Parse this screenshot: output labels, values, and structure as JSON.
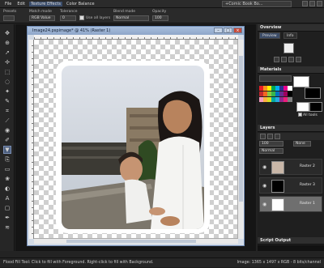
{
  "menubar": {
    "items": [
      "File",
      "Edit",
      "Texture Effects",
      "Color Balance"
    ],
    "search_value": "+Comic Book Bo..."
  },
  "toolbar": {
    "presets_label": "Presets",
    "match_mode_label": "Match mode",
    "match_mode_value": "RGB Value",
    "tolerance_label": "Tolerance",
    "tolerance_value": "0",
    "use_all_layers_label": "Use all layers",
    "blend_mode_label": "Blend mode",
    "blend_mode_value": "Normal",
    "opacity_label": "Opacity",
    "opacity_value": "100"
  },
  "document": {
    "title": "Image24.pspimage* @ 41% (Raster 1)"
  },
  "overview": {
    "title": "Overview",
    "tab_preview": "Preview",
    "tab_info": "Info"
  },
  "materials": {
    "title": "Materials",
    "all_tools_label": "All tools",
    "swatch_colors": [
      "#e81d25",
      "#f7941d",
      "#fff200",
      "#00a651",
      "#00aeef",
      "#2e3192",
      "#ec008c",
      "#ffffff",
      "#c1272d",
      "#f26522",
      "#8dc63f",
      "#39b54a",
      "#0072bc",
      "#662d91",
      "#9e005d",
      "#000000",
      "#f49ac1",
      "#fbb040",
      "#d7df23",
      "#00a99d",
      "#27aae1",
      "#92278f",
      "#ed1e79",
      "#808080"
    ]
  },
  "layers": {
    "title": "Layers",
    "opacity_value": "100",
    "mode_value": "Normal",
    "lock_value": "None",
    "items": [
      {
        "name": "Raster 2"
      },
      {
        "name": "Raster 3"
      },
      {
        "name": "Raster 1"
      }
    ]
  },
  "script_output": {
    "title": "Script Output"
  },
  "status": {
    "left": "Flood Fill Tool: Click to fill with Foreground. Right-click to fill with Background.",
    "right": "Image: 1365 x 1497 x RGB - 8 bits/channel"
  }
}
